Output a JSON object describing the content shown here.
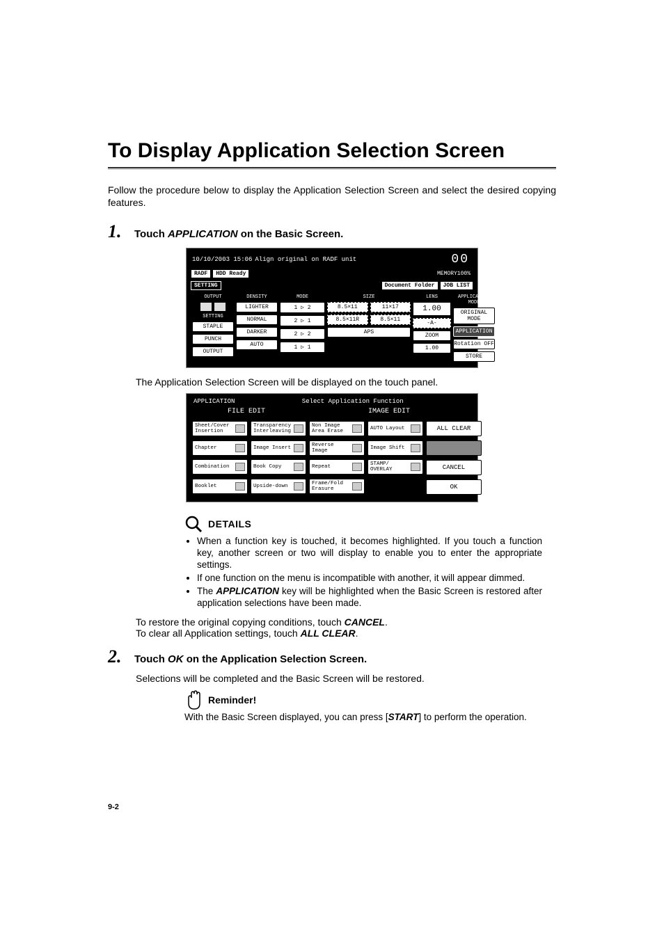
{
  "title": "To Display Application Selection Screen",
  "intro": "Follow the procedure below to display the Application Selection Screen and select the desired copying features.",
  "step1": {
    "num": "1.",
    "text_a": "Touch ",
    "text_b": "APPLICATION",
    "text_c": " on the Basic Screen."
  },
  "caption1": "The Application Selection Screen will be displayed on the touch panel.",
  "details": {
    "label": "DETAILS",
    "b1": "When a function key is touched, it becomes highlighted. If you touch a function key, another screen or two will display to enable you to enter the appropriate settings.",
    "b2": "If one function on the menu is incompatible with another, it will appear dimmed.",
    "b3_a": "The ",
    "b3_b": "APPLICATION",
    "b3_c": " key will be highlighted when the Basic Screen is restored after application selections have been made."
  },
  "restore_a": "To restore the original copying conditions, touch ",
  "restore_b": "CANCEL",
  "restore_c": ".",
  "clear_a": "To clear all Application settings, touch ",
  "clear_b": "ALL CLEAR",
  "clear_c": ".",
  "step2": {
    "num": "2.",
    "text_a": "Touch ",
    "text_b": "OK",
    "text_c": " on the Application Selection Screen.",
    "sub": "Selections will be completed and the Basic Screen will be restored."
  },
  "reminder": {
    "label": "Reminder!",
    "text_a": "With the Basic Screen displayed, you can press [",
    "text_b": "START",
    "text_c": "] to perform the operation."
  },
  "pagenum": "9-2",
  "basic_screen": {
    "datetime": "10/10/2003 15:06",
    "message": "Align original on RADF unit",
    "counter": "00",
    "memory": "MEMORY100%",
    "tabs": {
      "radf": "RADF",
      "hdd": "HDD Ready",
      "setting": "SETTING",
      "docfolder": "Document Folder",
      "joblist": "JOB LIST"
    },
    "groups": {
      "output": "OUTPUT",
      "density": "DENSITY",
      "mode": "MODE",
      "size": "SIZE",
      "lens": "LENS",
      "setting": "SETTING"
    },
    "density": {
      "lighter": "LIGHTER",
      "normal": "NORMAL",
      "darker": "DARKER",
      "auto": "AUTO"
    },
    "mode": {
      "m1": "1 ▷ 2",
      "m2": "2 ▷ 1",
      "m3": "2 ▷ 2",
      "m4": "1 ▷ 1"
    },
    "size": {
      "s1": "8.5×11",
      "s2": "11×17",
      "s3": "8.5×11R",
      "s4": "8.5×11",
      "aps": "APS"
    },
    "lens": {
      "ratio": "1.00",
      "dash": "-A-",
      "zoom": "ZOOM",
      "ratio2": "1.00"
    },
    "right": {
      "appmode": "APPLICATION MODE",
      "origmode": "ORIGINAL MODE",
      "application": "APPLICATION",
      "rotation": "Rotation OFF",
      "store": "STORE"
    },
    "setting_btns": {
      "staple": "STAPLE",
      "punch": "PUNCH",
      "output": "OUTPUT"
    }
  },
  "app_screen": {
    "title_left": "APPLICATION",
    "title_center": "Select Application Function",
    "headers": {
      "left": "FILE EDIT",
      "right": "IMAGE EDIT"
    },
    "buttons": {
      "r1": [
        "Sheet/Cover Insertion",
        "Transparency Interleaving",
        "Non Image Area Erase",
        "AUTO Layout"
      ],
      "r2": [
        "Chapter",
        "Image Insert",
        "Reverse Image",
        "Image Shift"
      ],
      "r3": [
        "Combination",
        "Book Copy",
        "Repeat",
        "STAMP/ OVERLAY"
      ],
      "r4": [
        "Booklet",
        "Upside-down",
        "Frame/Fold Erasure",
        ""
      ]
    },
    "side": {
      "allclear": "ALL CLEAR",
      "cancel": "CANCEL",
      "ok": "OK"
    }
  }
}
